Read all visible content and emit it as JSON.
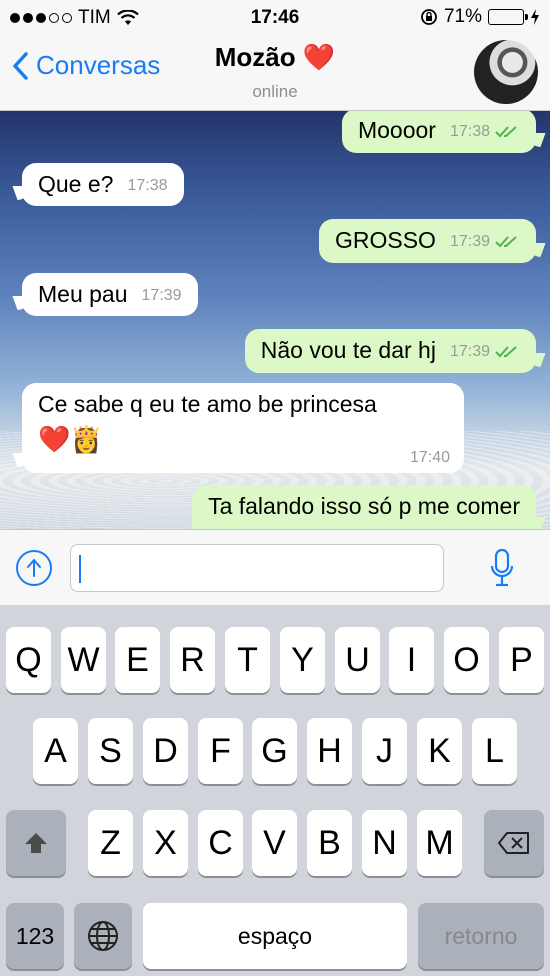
{
  "status": {
    "carrier": "TIM",
    "time": "17:46",
    "battery": "71%",
    "battery_level": 0.71
  },
  "header": {
    "back_label": "Conversas",
    "title": "Mozão",
    "title_emoji": "❤️",
    "subtitle": "online"
  },
  "messages": [
    {
      "dir": "out",
      "text": "Moooor",
      "time": "17:38",
      "read": true
    },
    {
      "dir": "in",
      "text": "Que e?",
      "time": "17:38"
    },
    {
      "dir": "out",
      "text": "GROSSO",
      "time": "17:39",
      "read": true
    },
    {
      "dir": "in",
      "text": "Meu pau",
      "time": "17:39"
    },
    {
      "dir": "out",
      "text": "Não vou te dar hj",
      "time": "17:39",
      "read": true
    },
    {
      "dir": "in",
      "text": "Ce sabe q eu te amo be princesa",
      "emoji": "❤️👸",
      "time": "17:40"
    },
    {
      "dir": "out",
      "text": "Ta falando isso só p me comer",
      "time": ""
    }
  ],
  "input": {
    "value": "",
    "placeholder": ""
  },
  "keyboard": {
    "row1": [
      "Q",
      "W",
      "E",
      "R",
      "T",
      "Y",
      "U",
      "I",
      "O",
      "P"
    ],
    "row2": [
      "A",
      "S",
      "D",
      "F",
      "G",
      "H",
      "J",
      "K",
      "L"
    ],
    "row3": [
      "Z",
      "X",
      "C",
      "V",
      "B",
      "N",
      "M"
    ],
    "numbers_label": "123",
    "space_label": "espaço",
    "return_label": "retorno"
  },
  "colors": {
    "accent": "#1a7cf5",
    "outgoing_bubble": "#dcf8c6",
    "incoming_bubble": "#ffffff",
    "read_ticks": "#4fb34f"
  }
}
